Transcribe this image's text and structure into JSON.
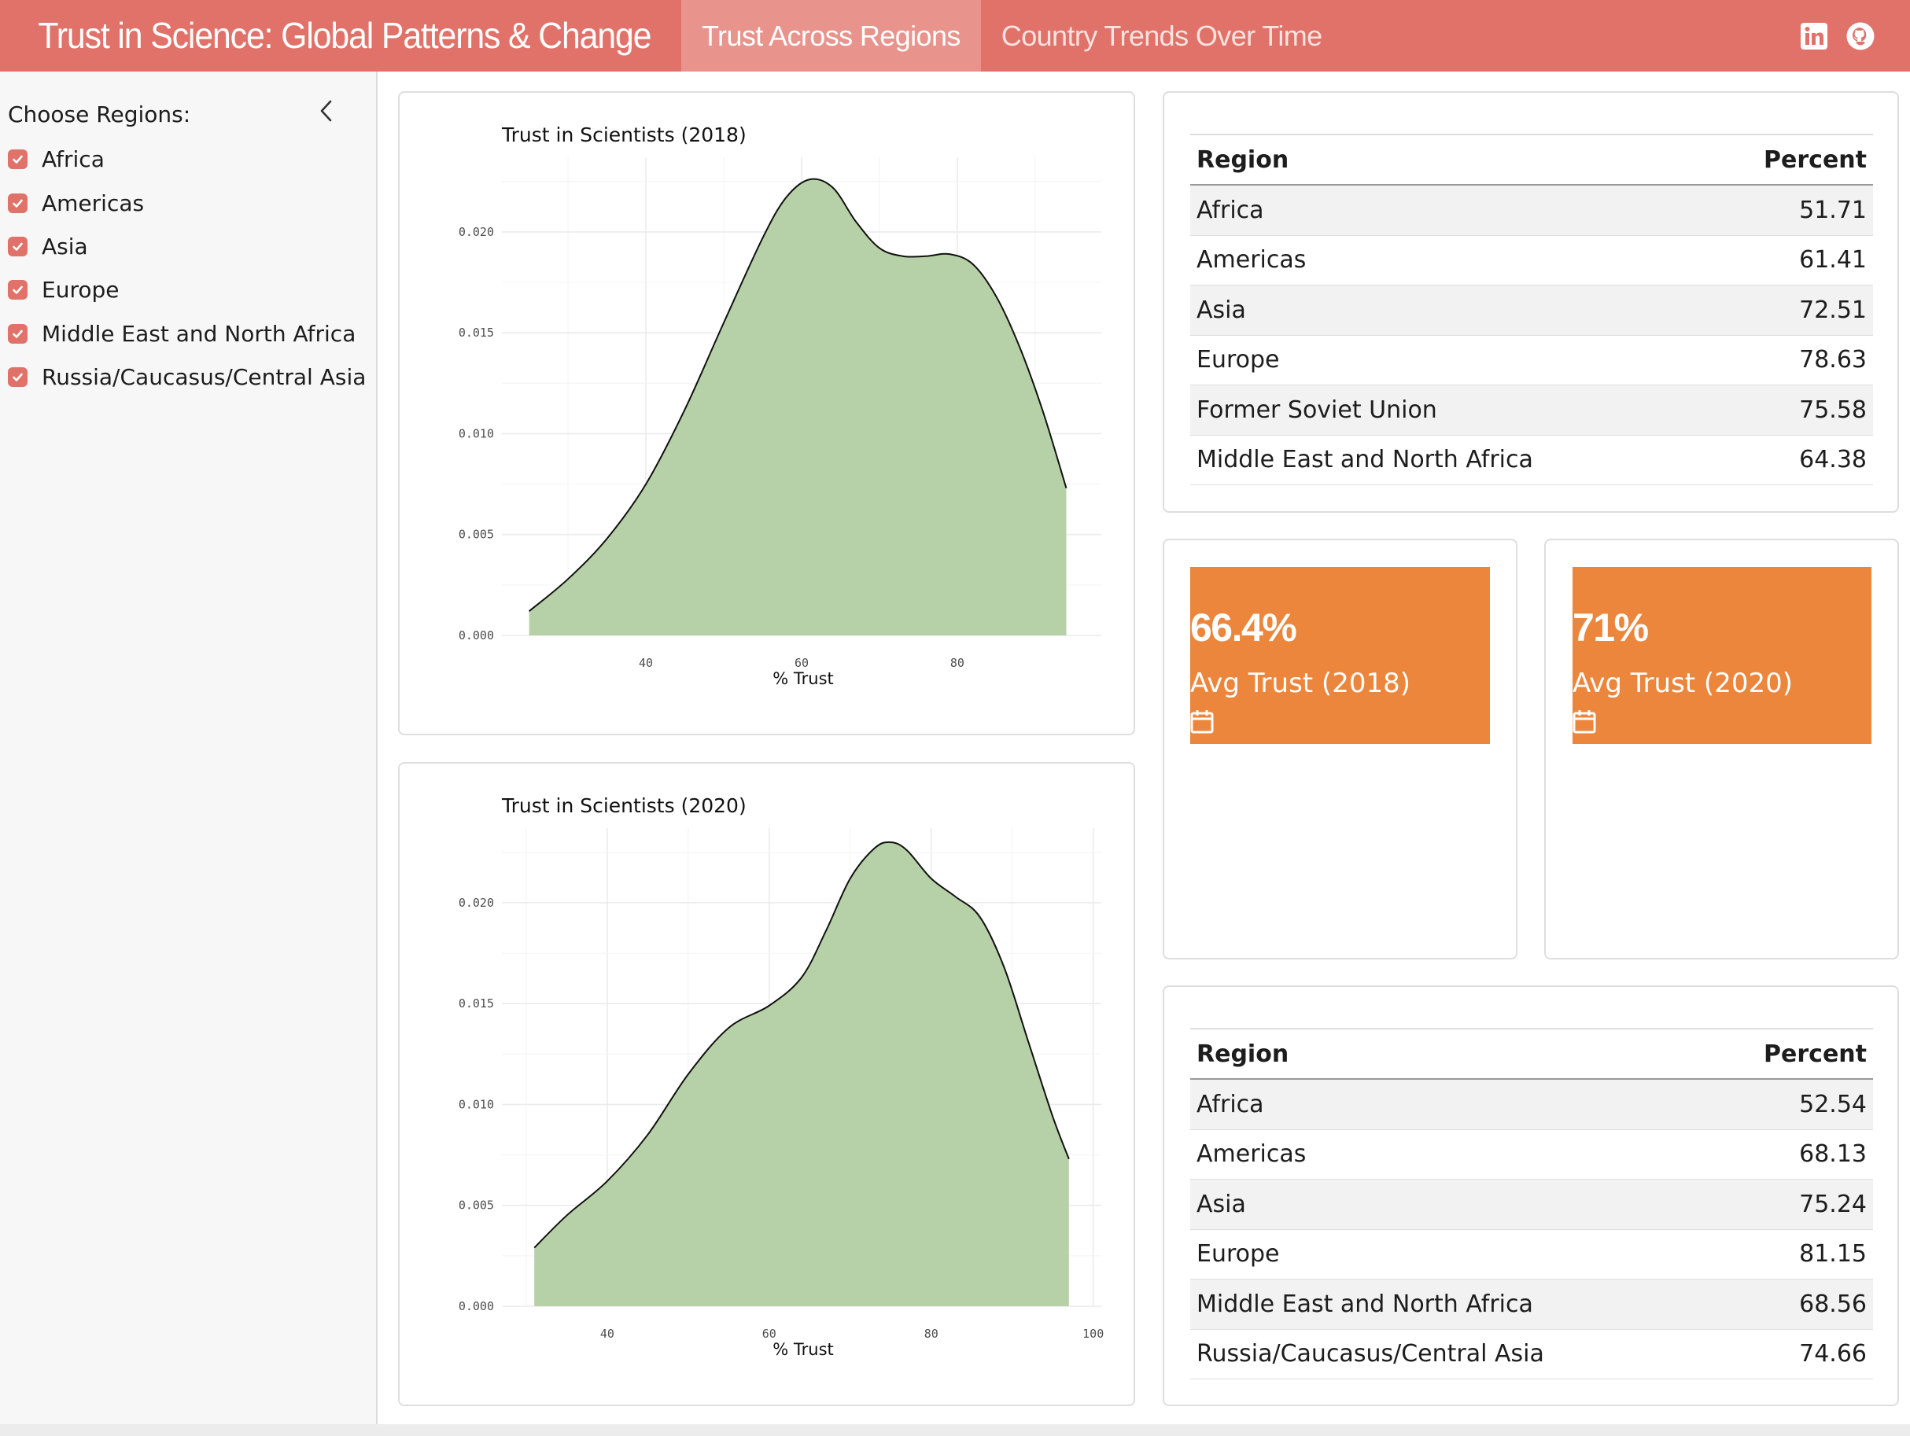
{
  "navbar": {
    "title": "Trust in Science: Global Patterns & Change",
    "tabs": [
      {
        "label": "Trust Across Regions",
        "active": true
      },
      {
        "label": "Country Trends Over Time",
        "active": false
      }
    ],
    "icons": [
      "linkedin-icon",
      "github-icon"
    ],
    "color": "#e0726a"
  },
  "sidebar": {
    "title": "Choose Regions:",
    "regions": [
      {
        "label": "Africa",
        "checked": true
      },
      {
        "label": "Americas",
        "checked": true
      },
      {
        "label": "Asia",
        "checked": true
      },
      {
        "label": "Europe",
        "checked": true
      },
      {
        "label": "Middle East and North Africa",
        "checked": true
      },
      {
        "label": "Russia/Caucasus/Central Asia",
        "checked": true
      }
    ]
  },
  "chart_data": [
    {
      "type": "area",
      "title": "Trust in Scientists (2018)",
      "xlabel": "% Trust",
      "ylabel": "",
      "xlim": [
        21.5,
        98.5
      ],
      "ylim": [
        0,
        0.0237
      ],
      "x_ticks": [
        "40",
        "60",
        "80"
      ],
      "y_ticks": [
        "0.000",
        "0.005",
        "0.010",
        "0.015",
        "0.020"
      ],
      "fill": "#b6d1a7",
      "x": [
        25,
        30,
        35,
        40,
        45,
        50,
        55,
        58,
        61,
        64,
        67,
        70,
        73,
        76,
        79,
        82,
        85,
        88,
        91,
        94
      ],
      "y": [
        0.0012,
        0.0028,
        0.0048,
        0.0075,
        0.0112,
        0.0155,
        0.0197,
        0.0217,
        0.0226,
        0.0222,
        0.0205,
        0.0192,
        0.0188,
        0.0188,
        0.0189,
        0.0184,
        0.0168,
        0.0143,
        0.0111,
        0.0073
      ],
      "grid": true
    },
    {
      "type": "area",
      "title": "Trust in Scientists (2020)",
      "xlabel": "% Trust",
      "ylabel": "",
      "xlim": [
        27,
        101
      ],
      "ylim": [
        0,
        0.0237
      ],
      "x_ticks": [
        "40",
        "60",
        "80",
        "100"
      ],
      "y_ticks": [
        "0.000",
        "0.005",
        "0.010",
        "0.015",
        "0.020"
      ],
      "fill": "#b6d1a7",
      "x": [
        31,
        35,
        40,
        45,
        50,
        55,
        60,
        64,
        67,
        70,
        73,
        75,
        77,
        80,
        83,
        86,
        89,
        92,
        95,
        97
      ],
      "y": [
        0.0029,
        0.0045,
        0.0062,
        0.0085,
        0.0115,
        0.0138,
        0.0149,
        0.0163,
        0.0186,
        0.0212,
        0.0227,
        0.023,
        0.0226,
        0.0212,
        0.0203,
        0.0193,
        0.0168,
        0.0131,
        0.0094,
        0.0073
      ],
      "grid": true
    }
  ],
  "table_2018": {
    "headers": [
      "Region",
      "Percent"
    ],
    "rows": [
      [
        "Africa",
        "51.71"
      ],
      [
        "Americas",
        "61.41"
      ],
      [
        "Asia",
        "72.51"
      ],
      [
        "Europe",
        "78.63"
      ],
      [
        "Former Soviet Union",
        "75.58"
      ],
      [
        "Middle East and North Africa",
        "64.38"
      ]
    ]
  },
  "table_2020": {
    "headers": [
      "Region",
      "Percent"
    ],
    "rows": [
      [
        "Africa",
        "52.54"
      ],
      [
        "Americas",
        "68.13"
      ],
      [
        "Asia",
        "75.24"
      ],
      [
        "Europe",
        "81.15"
      ],
      [
        "Middle East and North Africa",
        "68.56"
      ],
      [
        "Russia/Caucasus/Central Asia",
        "74.66"
      ]
    ]
  },
  "value_boxes": [
    {
      "value": "66.4%",
      "label": "Avg Trust (2018)",
      "icon": "calendar-icon",
      "color": "#ec863c"
    },
    {
      "value": "71%",
      "label": "Avg Trust (2020)",
      "icon": "calendar-icon",
      "color": "#ec863c"
    }
  ]
}
